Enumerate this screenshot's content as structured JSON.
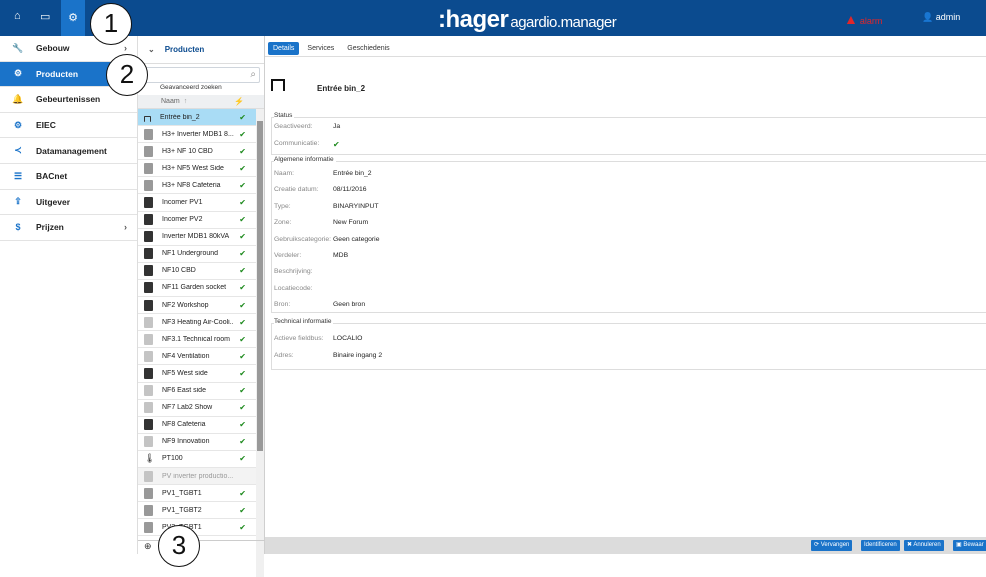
{
  "topbar": {
    "brand": ":hager",
    "brand_sub": "agardio.manager",
    "alert_label": "alarm",
    "user": "admin"
  },
  "callouts": [
    "1",
    "2",
    "3"
  ],
  "sidebar": {
    "items": [
      {
        "label": "Gebouw",
        "icon": "wrench-icon",
        "glyph": "🔧",
        "chevron": true,
        "active": false
      },
      {
        "label": "Producten",
        "icon": "product-icon",
        "glyph": "⚙",
        "chevron": false,
        "active": true
      },
      {
        "label": "Gebeurtenissen",
        "icon": "bell-icon",
        "glyph": "🔔",
        "chevron": false,
        "active": false
      },
      {
        "label": "EIEC",
        "icon": "gears-icon",
        "glyph": "⚙",
        "chevron": false,
        "active": false
      },
      {
        "label": "Datamanagement",
        "icon": "share-icon",
        "glyph": "≺",
        "chevron": false,
        "active": false
      },
      {
        "label": "BACnet",
        "icon": "server-icon",
        "glyph": "☰",
        "chevron": false,
        "active": false
      },
      {
        "label": "Uitgever",
        "icon": "upload-icon",
        "glyph": "⇪",
        "chevron": false,
        "active": false
      },
      {
        "label": "Prijzen",
        "icon": "dollar-icon",
        "glyph": "$",
        "chevron": true,
        "active": false
      }
    ]
  },
  "product_list": {
    "header": "Producten",
    "search_placeholder": "",
    "advanced_search": "Geavanceerd zoeken",
    "column_name": "Naam",
    "rows": [
      {
        "name": "Entrée bin_2",
        "icon": "signal",
        "ok": true,
        "selected": true
      },
      {
        "name": "H3+ Inverter MDB1 8...",
        "icon": "gray",
        "ok": true
      },
      {
        "name": "H3+ NF 10 CBD",
        "icon": "gray",
        "ok": true
      },
      {
        "name": "H3+ NF5 West Side",
        "icon": "gray",
        "ok": true
      },
      {
        "name": "H3+ NF8 Cafeteria",
        "icon": "gray",
        "ok": true
      },
      {
        "name": "Incomer PV1",
        "icon": "dark",
        "ok": true
      },
      {
        "name": "Incomer PV2",
        "icon": "dark",
        "ok": true
      },
      {
        "name": "Inverter MDB1 80kVA",
        "icon": "dark",
        "ok": true
      },
      {
        "name": "NF1 Underground",
        "icon": "dark",
        "ok": true
      },
      {
        "name": "NF10 CBD",
        "icon": "dark",
        "ok": true
      },
      {
        "name": "NF11 Garden socket",
        "icon": "dark",
        "ok": true
      },
      {
        "name": "NF2 Workshop",
        "icon": "dark",
        "ok": true
      },
      {
        "name": "NF3 Heating Air-Cooli...",
        "icon": "light",
        "ok": true
      },
      {
        "name": "NF3.1 Technical room",
        "icon": "light",
        "ok": true
      },
      {
        "name": "NF4 Ventilation",
        "icon": "light",
        "ok": true
      },
      {
        "name": "NF5 West side",
        "icon": "dark",
        "ok": true
      },
      {
        "name": "NF6 East side",
        "icon": "light",
        "ok": true
      },
      {
        "name": "NF7 Lab2 Show",
        "icon": "light",
        "ok": true
      },
      {
        "name": "NF8 Cafeteria",
        "icon": "dark",
        "ok": true
      },
      {
        "name": "NF9 Innovation",
        "icon": "light",
        "ok": true
      },
      {
        "name": "PT100",
        "icon": "thermo",
        "ok": true
      },
      {
        "name": "PV inverter productio...",
        "icon": "light",
        "ok": false,
        "dim": true
      },
      {
        "name": "PV1_TGBT1",
        "icon": "gray",
        "ok": true
      },
      {
        "name": "PV1_TGBT2",
        "icon": "gray",
        "ok": true
      },
      {
        "name": "PV2_TGBT1",
        "icon": "gray",
        "ok": true
      }
    ]
  },
  "main": {
    "tabs": [
      {
        "label": "Details",
        "active": true
      },
      {
        "label": "Services",
        "active": false
      },
      {
        "label": "Geschiedenis",
        "active": false
      }
    ],
    "title": "Entrée bin_2",
    "status": {
      "title": "Status",
      "rows": [
        {
          "label": "Geactiveerd:",
          "value": "Ja"
        },
        {
          "label": "Communicatie:",
          "value": "✔"
        }
      ]
    },
    "general": {
      "title": "Algemene informatie",
      "rows": [
        {
          "label": "Naam:",
          "value": "Entrée bin_2"
        },
        {
          "label": "Creatie datum:",
          "value": "08/11/2016"
        },
        {
          "label": "Type:",
          "value": "BINARYINPUT"
        },
        {
          "label": "Zone:",
          "value": "New Forum"
        },
        {
          "label": "Gebruikscategorie:",
          "value": "Geen categorie"
        },
        {
          "label": "Verdeler:",
          "value": "MDB"
        },
        {
          "label": "Beschrijving:",
          "value": ""
        },
        {
          "label": "Locatiecode:",
          "value": ""
        },
        {
          "label": "Bron:",
          "value": "Geen bron"
        }
      ]
    },
    "technical": {
      "title": "Technical informatie",
      "rows": [
        {
          "label": "Actieve fieldbus:",
          "value": "LOCALIO"
        },
        {
          "label": "Adres:",
          "value": "Binaire ingang 2"
        }
      ]
    },
    "footer_buttons": [
      {
        "label": "Vervangen",
        "icon": "replace-icon"
      },
      {
        "label": "Identificeren",
        "icon": ""
      },
      {
        "label": "Annuleren",
        "icon": "close-icon"
      },
      {
        "label": "Bewaar",
        "icon": "save-icon"
      }
    ]
  }
}
